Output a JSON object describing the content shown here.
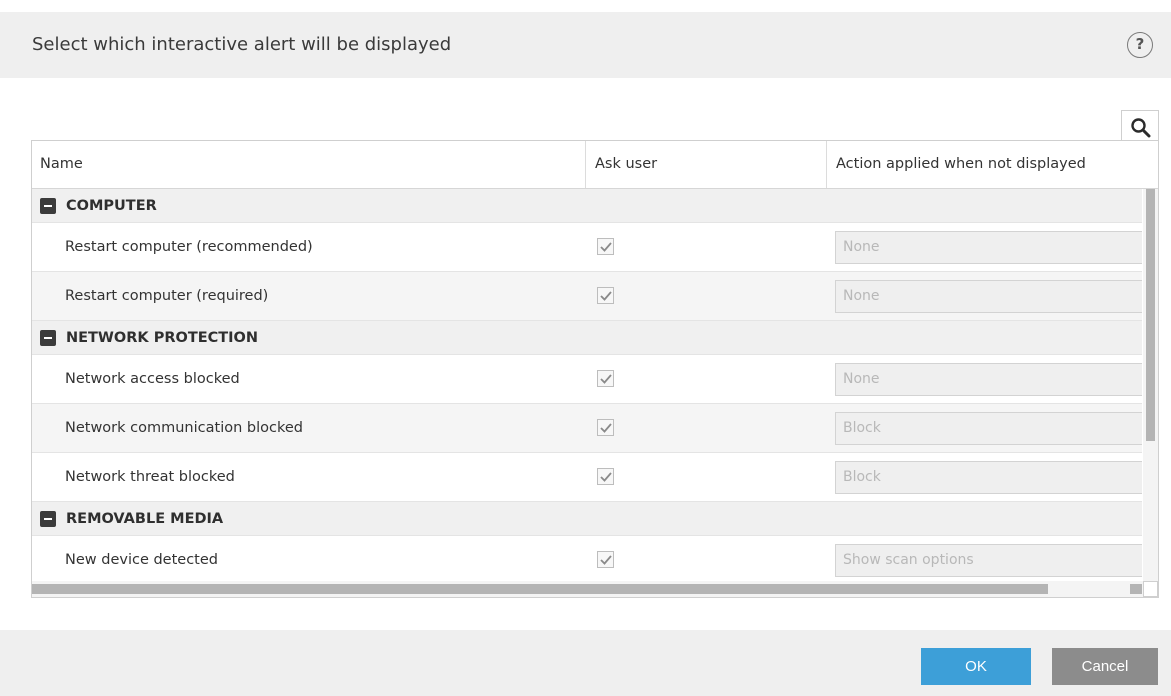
{
  "dialog": {
    "title": "Select which interactive alert will be displayed",
    "help_label": "?"
  },
  "table": {
    "columns": {
      "name": "Name",
      "ask_user": "Ask user",
      "action": "Action applied when not displayed"
    },
    "groups": [
      {
        "label": "COMPUTER",
        "items": [
          {
            "name": "Restart computer (recommended)",
            "ask_user": true,
            "action": "None"
          },
          {
            "name": "Restart computer (required)",
            "ask_user": true,
            "action": "None"
          }
        ]
      },
      {
        "label": "NETWORK PROTECTION",
        "items": [
          {
            "name": "Network access blocked",
            "ask_user": true,
            "action": "None"
          },
          {
            "name": "Network communication blocked",
            "ask_user": true,
            "action": "Block"
          },
          {
            "name": "Network threat blocked",
            "ask_user": true,
            "action": "Block"
          }
        ]
      },
      {
        "label": "REMOVABLE MEDIA",
        "items": [
          {
            "name": "New device detected",
            "ask_user": true,
            "action": "Show scan options"
          }
        ]
      }
    ]
  },
  "footer": {
    "ok_label": "OK",
    "cancel_label": "Cancel"
  },
  "colors": {
    "accent": "#3d9fd8",
    "cancel": "#8c8c8c",
    "header_bg": "#efefef"
  }
}
